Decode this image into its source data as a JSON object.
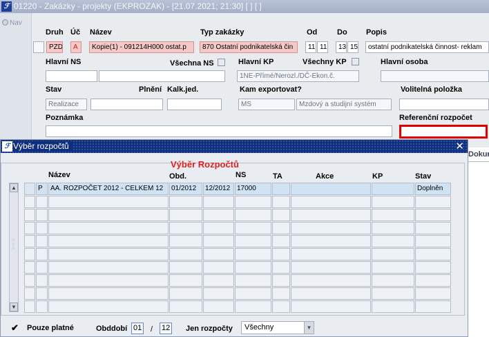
{
  "window": {
    "title": "01220 - Zakázky - projekty (EKPROZAK) - [21.07.2021; 21:30]  [ ]  [ ]"
  },
  "nav": {
    "label": "Nav"
  },
  "form": {
    "druh": {
      "label": "Druh",
      "value": "PZD"
    },
    "uc": {
      "label": "Úč",
      "value": "A"
    },
    "nazev": {
      "label": "Název",
      "value": "Kopie(1) - 091214H000 ostat.p"
    },
    "typ": {
      "label": "Typ zakázky",
      "value": "870 Ostatní podnikatelská čin"
    },
    "od": {
      "label": "Od",
      "v1": "11",
      "v2": "11"
    },
    "do": {
      "label": "Do",
      "v1": "13",
      "v2": "15"
    },
    "popis": {
      "label": "Popis",
      "value": "ostatní podnikatelská činnost- reklam"
    },
    "hlavni_ns": {
      "label": "Hlavní NS",
      "value": ""
    },
    "vsechna_ns": {
      "label": "Všechna NS"
    },
    "hlavni_kp": {
      "label": "Hlavní KP",
      "value": "1NE-Přímé/Nerozl./DČ-Ekon.č."
    },
    "vsechny_kp": {
      "label": "Všechny KP"
    },
    "hlavni_osoba": {
      "label": "Hlavní osoba"
    },
    "stav": {
      "label": "Stav",
      "value": "Realizace"
    },
    "plneni": {
      "label": "Plnění"
    },
    "kalk": {
      "label": "Kalk.jed."
    },
    "export": {
      "label": "Kam exportovat?",
      "v1": "MS",
      "v2": "Mzdový a studijní systém"
    },
    "volitelna": {
      "label": "Volitelná položka"
    },
    "poznamka": {
      "label": "Poznámka"
    },
    "ref_rozpocet": {
      "label": "Referenční rozpočet"
    },
    "dokum": {
      "label": "Dokum"
    }
  },
  "dialog": {
    "title": "Výběr rozpočtů",
    "heading": "Výběr Rozpočtů",
    "columns": {
      "nazev": "Název",
      "obd": "Obd.",
      "ns": "NS",
      "ta": "TA",
      "akce": "Akce",
      "kp": "KP",
      "stav": "Stav"
    },
    "rows": [
      {
        "flag": "P",
        "nazev": "AA. ROZPOČET 2012 - CELKEM 12",
        "od": "01/2012",
        "do": "12/2012",
        "ns": "17000",
        "ta": "",
        "akce": "",
        "kp": "",
        "stav": "Doplněn"
      }
    ],
    "empty_rows": 9,
    "footer": {
      "pouze_platne": "Pouze platné",
      "obdobi_label": "Obddobí",
      "obdobi_from": "01",
      "slash": "/",
      "obdobi_to": "12",
      "jen_label": "Jen rozpočty",
      "jen_value": "Všechny"
    }
  },
  "colors": {
    "titlebar": "#a4b0c8",
    "dialog_title": "#0f2f7c",
    "accent_red": "#e02020",
    "selected_row": "#cfe3f5"
  }
}
